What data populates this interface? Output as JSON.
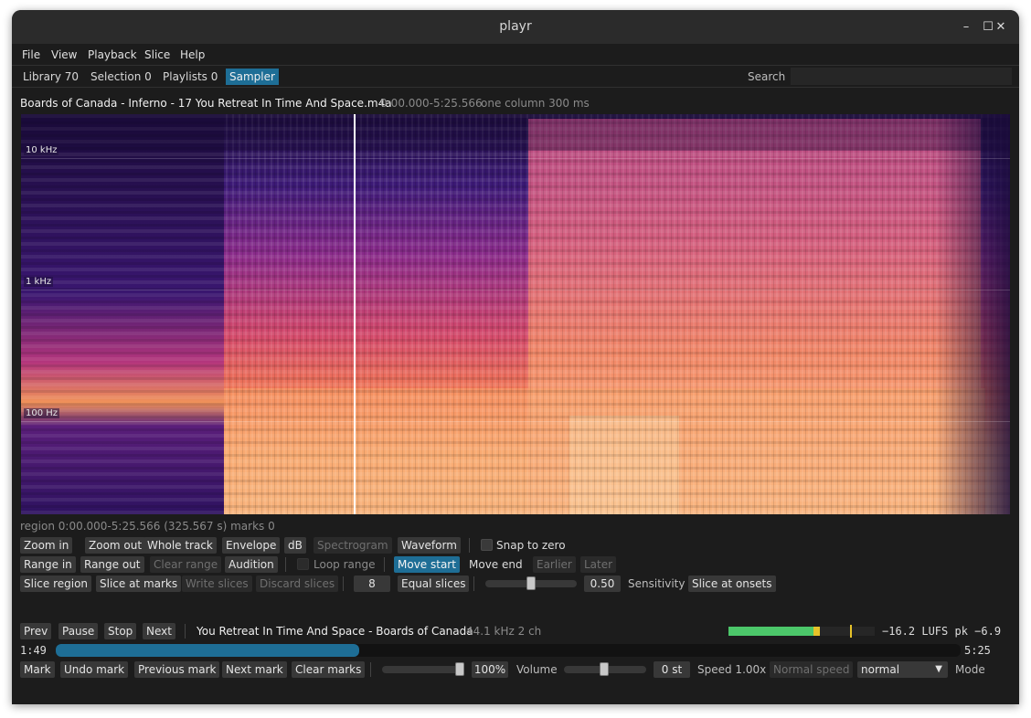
{
  "window": {
    "title": "playr",
    "minimize": "–",
    "maximize": "☐",
    "close": "✕"
  },
  "menu": [
    "File",
    "View",
    "Playback",
    "Slice",
    "Help"
  ],
  "tabs": [
    "Library 70",
    "Selection 0",
    "Playlists 0",
    "Sampler"
  ],
  "active_tab": "Sampler",
  "search": {
    "label": "Search",
    "value": ""
  },
  "file": {
    "name": "Boards of Canada - Inferno - 17 You Retreat In Time And Space.m4a",
    "range": "0:00.000-5:25.566",
    "column_info": "one column 300 ms"
  },
  "spectrogram": {
    "labels": [
      "10 kHz",
      "1 kHz",
      "100 Hz"
    ],
    "playhead_fraction": 0.336
  },
  "region": {
    "status": "region 0:00.000-5:25.566 (325.567 s)  marks 0"
  },
  "toolbar1": {
    "zoom_in": "Zoom in",
    "zoom_out": "Zoom out",
    "whole_track": "Whole track",
    "envelope": "Envelope",
    "db": "dB",
    "spectrogram": "Spectrogram",
    "waveform": "Waveform",
    "snap_to_zero": "Snap to zero"
  },
  "toolbar2": {
    "range_in": "Range in",
    "range_out": "Range out",
    "clear_range": "Clear range",
    "audition": "Audition",
    "loop_range": "Loop range",
    "move_start": "Move start",
    "move_end": "Move end",
    "earlier": "Earlier",
    "later": "Later"
  },
  "toolbar3": {
    "slice_region": "Slice region",
    "slice_at_marks": "Slice at marks",
    "write_slices": "Write slices",
    "discard_slices": "Discard slices",
    "slice_count": "8",
    "equal_slices": "Equal slices",
    "sensitivity_value": "0.50",
    "sensitivity_label": "Sensitivity",
    "sensitivity_level": 0.5,
    "slice_at_onsets": "Slice at onsets"
  },
  "transport": {
    "prev": "Prev",
    "pause": "Pause",
    "stop": "Stop",
    "next": "Next",
    "track": "You Retreat In Time And Space - Boards of Canada",
    "format": "44.1 kHz 2 ch",
    "loudness": "−16.2 LUFS pk −6.9",
    "meter_level": 0.58,
    "meter_peak": 0.83
  },
  "progress": {
    "elapsed": "1:49",
    "total": "5:25",
    "fraction": 0.335
  },
  "bottom": {
    "mark": "Mark",
    "undo_mark": "Undo mark",
    "previous_mark": "Previous mark",
    "next_mark": "Next mark",
    "clear_marks": "Clear marks",
    "volume_value": "100%",
    "volume_label": "Volume",
    "volume_level": 1.0,
    "pitch_value": "0 st",
    "speed_label": "Speed 1.00x",
    "normal_speed": "Normal speed",
    "mode_value": "normal",
    "mode_label": "Mode"
  },
  "colors": {
    "accent": "#1e6e96",
    "meter_green": "#4cc76a",
    "meter_yellow": "#e6c229"
  }
}
